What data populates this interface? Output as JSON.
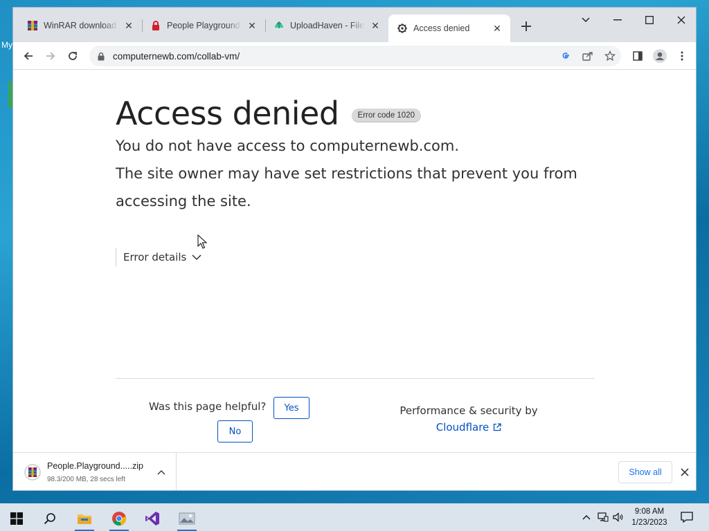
{
  "desktop": {
    "label": "My"
  },
  "tabs": [
    {
      "title": "WinRAR download fr",
      "favicon": "winrar-icon",
      "active": false
    },
    {
      "title": "People Playground Fr",
      "favicon": "lock-badge-icon",
      "active": false
    },
    {
      "title": "UploadHaven - File S",
      "favicon": "uploadhaven-icon",
      "active": false
    },
    {
      "title": "Access denied",
      "favicon": "page-gear-icon",
      "active": true
    }
  ],
  "window_controls": {
    "tab_search": "⌄",
    "minimize": "—",
    "maximize": "☐",
    "close": "✕"
  },
  "toolbar": {
    "url": "computernewb.com/collab-vm/"
  },
  "page": {
    "title": "Access denied",
    "error_code": "Error code 1020",
    "line1": "You do not have access to computernewb.com.",
    "line2": "The site owner may have set restrictions that prevent you from accessing the site.",
    "details_label": "Error details",
    "helpful_question": "Was this page helpful?",
    "yes_label": "Yes",
    "no_label": "No",
    "perf_text": "Performance & security by",
    "cloudflare_label": "Cloudflare"
  },
  "download": {
    "file_name": "People.Playground.....zip",
    "status": "98.3/200 MB, 28 secs left",
    "show_all": "Show all"
  },
  "taskbar": {
    "time": "9:08 AM",
    "date": "1/23/2023",
    "apps": [
      "start-icon",
      "search-icon",
      "file-explorer-icon",
      "chrome-icon",
      "visual-studio-icon",
      "photos-icon"
    ]
  },
  "colors": {
    "link": "#0051c3",
    "tab_bg": "#dee1e6",
    "taskbar_bg": "#dbe3ec"
  }
}
